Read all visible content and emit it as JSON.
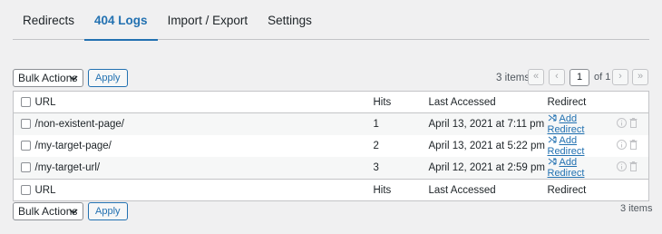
{
  "tabs": [
    {
      "label": "Redirects",
      "active": false
    },
    {
      "label": "404 Logs",
      "active": true
    },
    {
      "label": "Import / Export",
      "active": false
    },
    {
      "label": "Settings",
      "active": false
    }
  ],
  "bulk": {
    "selected": "Bulk Actions",
    "apply": "Apply"
  },
  "pagination": {
    "count": "3 items",
    "first": "«",
    "prev": "‹",
    "page": "1",
    "of": "of 1",
    "next": "›",
    "last": "»"
  },
  "table": {
    "columns": [
      "URL",
      "Hits",
      "Last Accessed",
      "Redirect"
    ],
    "rows": [
      {
        "url": "/non-existent-page/",
        "hits": "1",
        "last": "April 13, 2021 at 7:11 pm",
        "redirect": "Add Redirect"
      },
      {
        "url": "/my-target-page/",
        "hits": "2",
        "last": "April 13, 2021 at 5:22 pm",
        "redirect": "Add Redirect"
      },
      {
        "url": "/my-target-url/",
        "hits": "3",
        "last": "April 12, 2021 at 2:59 pm",
        "redirect": "Add Redirect"
      }
    ]
  },
  "icons": {
    "redirect": "shuffle-icon",
    "info": "info-icon",
    "delete": "trash-icon",
    "dropdown": "chevron-down-icon"
  },
  "colors": {
    "accent": "#2271b1",
    "background": "#f0f0f1"
  }
}
